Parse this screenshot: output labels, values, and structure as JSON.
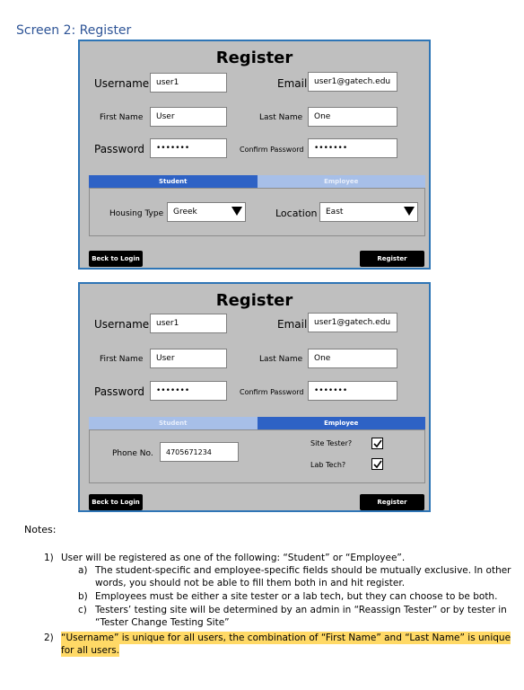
{
  "screen_title": "Screen 2: Register",
  "panel_title": "Register",
  "labels": {
    "username": "Username",
    "email": "Email",
    "first_name": "First Name",
    "last_name": "Last Name",
    "password": "Password",
    "confirm_password": "Confirm Password",
    "housing_type": "Housing Type",
    "location": "Location",
    "phone": "Phone No.",
    "site_tester": "Site Tester?",
    "lab_tech": "Lab Tech?"
  },
  "values": {
    "username": "user1",
    "email": "user1@gatech.edu",
    "first_name": "User",
    "last_name": "One",
    "password": "•••••••",
    "confirm_password": "•••••••",
    "housing_type": "Greek",
    "location": "East",
    "phone": "4705671234"
  },
  "tabs": {
    "student": "Student",
    "employee": "Employee"
  },
  "buttons": {
    "back": "Beck to Login",
    "register": "Register"
  },
  "checkboxes": {
    "site_tester": true,
    "lab_tech": true
  },
  "icons": {
    "dropdown": "triangle-down-icon",
    "checkbox": "check-icon"
  },
  "notes": {
    "heading": "Notes:",
    "n1_num": "1)",
    "n1": "User will be registered as one of the following: “Student” or “Employee”.",
    "a_num": "a)",
    "a1": "The student-specific and employee-specific fields should be mutually exclusive. In other",
    "a2": "words, you should not be able to fill them both in and hit register.",
    "b_num": "b)",
    "b1": "Employees must be either a site tester or a lab tech, but they can choose to be both.",
    "c_num": "c)",
    "c1": "Testers’ testing site will be determined by an admin in “Reassign Tester” or by tester in",
    "c2": "“Tester Change Testing Site”",
    "n2_num": "2)",
    "n2a": "“Username” is unique for all users, the combination of “First Name” and “Last Name” is unique",
    "n2b": "for all users."
  }
}
